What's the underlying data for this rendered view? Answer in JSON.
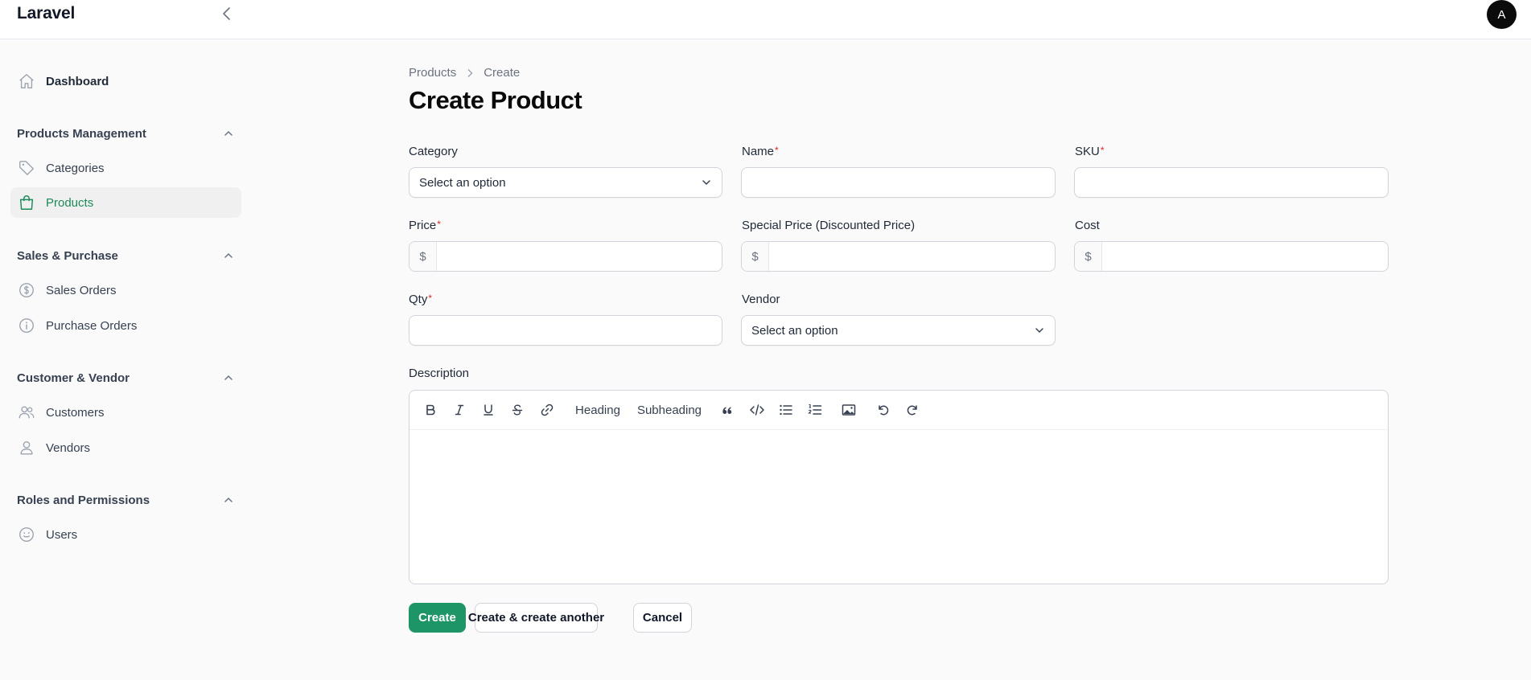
{
  "app": {
    "brand": "Laravel",
    "avatar_initial": "A"
  },
  "sidebar": {
    "dashboard": "Dashboard",
    "groups": [
      {
        "label": "Products Management",
        "items": [
          "Categories",
          "Products"
        ]
      },
      {
        "label": "Sales & Purchase",
        "items": [
          "Sales Orders",
          "Purchase Orders"
        ]
      },
      {
        "label": "Customer & Vendor",
        "items": [
          "Customers",
          "Vendors"
        ]
      },
      {
        "label": "Roles and Permissions",
        "items": [
          "Users"
        ]
      }
    ],
    "active_item": "Products"
  },
  "breadcrumb": {
    "items": [
      "Products",
      "Create"
    ]
  },
  "page": {
    "title": "Create Product"
  },
  "form": {
    "category": {
      "label": "Category",
      "value": "Select an option"
    },
    "name": {
      "label": "Name",
      "required_mark": "*",
      "value": ""
    },
    "sku": {
      "label": "SKU",
      "required_mark": "*",
      "value": ""
    },
    "price": {
      "label": "Price",
      "required_mark": "*",
      "prefix": "$",
      "value": ""
    },
    "special_price": {
      "label": "Special Price (Discounted Price)",
      "prefix": "$",
      "value": ""
    },
    "cost": {
      "label": "Cost",
      "prefix": "$",
      "value": ""
    },
    "qty": {
      "label": "Qty",
      "required_mark": "*",
      "value": ""
    },
    "vendor": {
      "label": "Vendor",
      "value": "Select an option"
    },
    "description": {
      "label": "Description",
      "value": ""
    }
  },
  "editor_toolbar": {
    "heading": "Heading",
    "subheading": "Subheading",
    "icons": [
      "bold-icon",
      "italic-icon",
      "underline-icon",
      "strikethrough-icon",
      "link-icon",
      "quote-icon",
      "code-icon",
      "bullet-list-icon",
      "ordered-list-icon",
      "image-icon",
      "undo-icon",
      "redo-icon"
    ]
  },
  "actions": {
    "create": "Create",
    "create_another": "Create & create another",
    "cancel": "Cancel"
  },
  "colors": {
    "accent": "#1d9566",
    "required": "#dc2626",
    "active_nav": "#1d8a5a"
  }
}
